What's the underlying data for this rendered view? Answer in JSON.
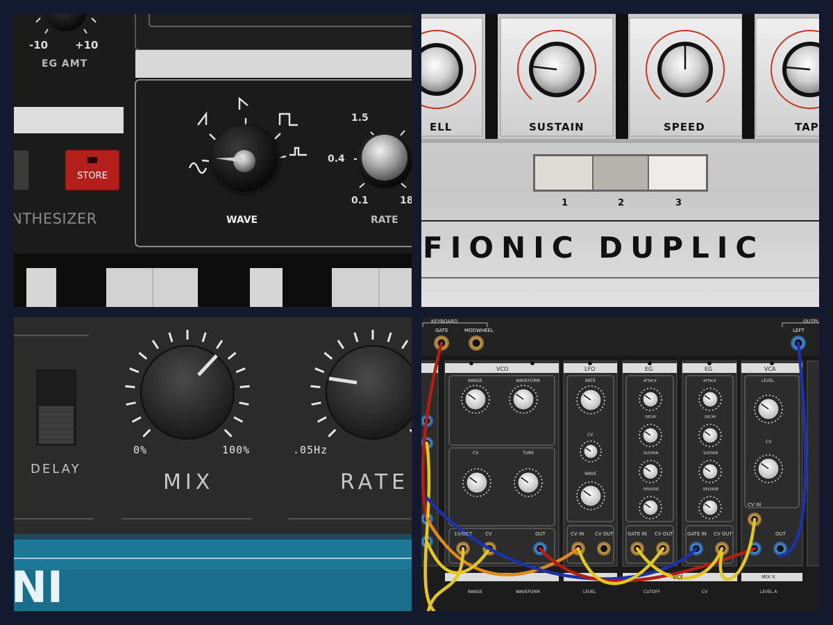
{
  "panel1": {
    "eg_amt": {
      "min": "-10",
      "max": "+10",
      "label": "EG AMT"
    },
    "store_label": "STORE",
    "brand_partial": "NTHESIZER",
    "wave_label": "WAVE",
    "rate": {
      "label": "RATE",
      "ticks": [
        "1.5",
        "0.4",
        "0.1",
        "18"
      ]
    }
  },
  "panel2": {
    "knob_labels": [
      "ELL",
      "SUSTAIN",
      "SPEED",
      "TAP"
    ],
    "buttons": [
      "1",
      "2",
      "3"
    ],
    "brand": "FIONIC DUPLIC"
  },
  "panel3": {
    "delay_label": "DELAY",
    "mix": {
      "label": "MIX",
      "min": "0%",
      "max": "100%"
    },
    "rate": {
      "label": "RATE",
      "min": ".05Hz"
    },
    "brand_partial": "NI"
  },
  "panel4": {
    "keyboard_label": "KEYBOARD",
    "output_label": "OUTPUT",
    "jacks_top": [
      "GATE",
      "MODWHEEL",
      "LEFT"
    ],
    "modules": [
      {
        "title": "VCO",
        "controls": [
          "RANGE",
          "WAVEFORM",
          "CV",
          "TUNE"
        ],
        "jacks": [
          "1V/OCT",
          "CV",
          "OUT"
        ]
      },
      {
        "title": "LFO",
        "controls": [
          "RATE",
          "CV",
          "WAVE"
        ],
        "jacks": [
          "CV IN",
          "CV OUT"
        ]
      },
      {
        "title": "EG",
        "controls": [
          "ATTACK",
          "DECAY",
          "SUSTAIN",
          "RELEASE"
        ],
        "jacks": [
          "GATE IN",
          "CV OUT"
        ]
      },
      {
        "title": "EG",
        "controls": [
          "ATTACK",
          "DECAY",
          "SUSTAIN",
          "RELEASE"
        ],
        "jacks": [
          "GATE IN",
          "CV OUT"
        ]
      },
      {
        "title": "VCA",
        "controls": [
          "LEVEL",
          "CV"
        ],
        "jacks": [
          "CV IN",
          "OUT"
        ]
      }
    ],
    "bottom_labels": [
      "RANGE",
      "WAVEFORM",
      "LEVEL",
      "CUTOFF",
      "CV",
      "MIX II",
      "LEVEL A"
    ],
    "vcf_title": "VCF"
  }
}
